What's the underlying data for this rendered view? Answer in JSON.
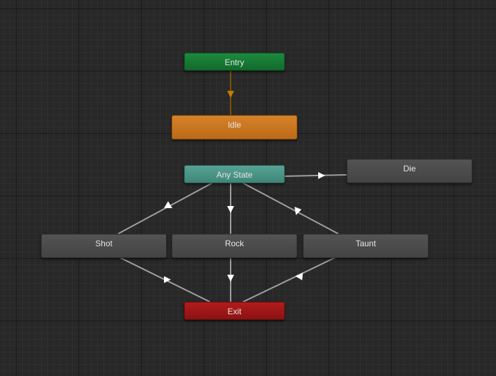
{
  "editor": {
    "colors": {
      "background": "#282828",
      "entry": "#1c8a3e",
      "idle_default": "#d7822a",
      "any_state": "#56a394",
      "state": "#4a4a4a",
      "exit": "#a51818",
      "transition_line": "#a0a0a0",
      "default_transition": "#7a5200"
    }
  },
  "nodes": {
    "entry": {
      "label": "Entry"
    },
    "idle": {
      "label": "Idle"
    },
    "any_state": {
      "label": "Any State"
    },
    "die": {
      "label": "Die"
    },
    "shot": {
      "label": "Shot"
    },
    "rock": {
      "label": "Rock"
    },
    "taunt": {
      "label": "Taunt"
    },
    "exit": {
      "label": "Exit"
    }
  },
  "transitions": [
    {
      "from": "Entry",
      "to": "Idle",
      "kind": "default"
    },
    {
      "from": "Any State",
      "to": "Die"
    },
    {
      "from": "Any State",
      "to": "Shot"
    },
    {
      "from": "Any State",
      "to": "Rock"
    },
    {
      "from": "Any State",
      "to": "Taunt"
    },
    {
      "from": "Shot",
      "to": "Exit"
    },
    {
      "from": "Rock",
      "to": "Exit"
    },
    {
      "from": "Taunt",
      "to": "Exit"
    }
  ]
}
